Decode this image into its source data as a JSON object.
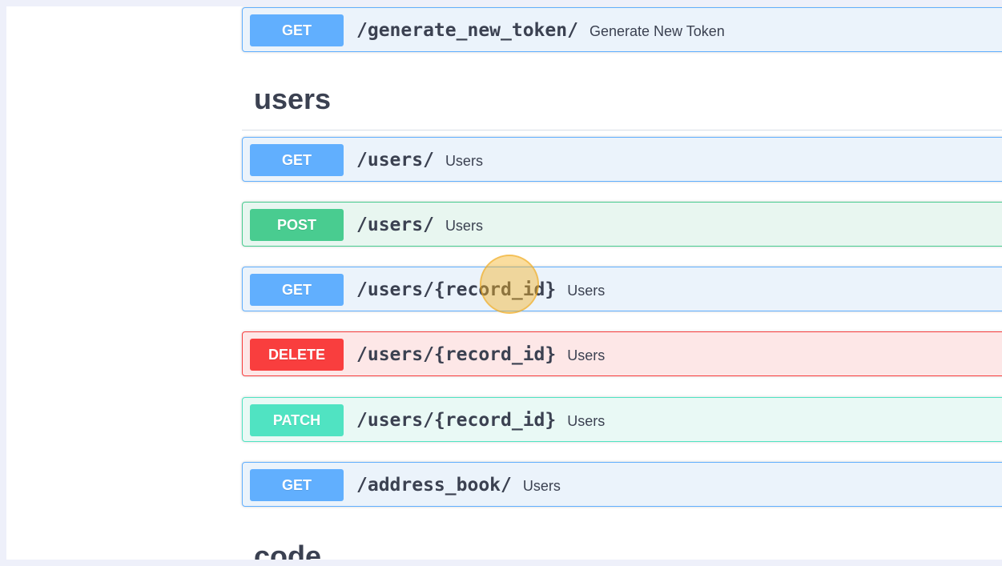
{
  "top_operation": {
    "method": "GET",
    "path": "/generate_new_token/",
    "summary": "Generate New Token"
  },
  "sections": {
    "users": {
      "title": "users",
      "operations": [
        {
          "method": "GET",
          "path": "/users/",
          "summary": "Users"
        },
        {
          "method": "POST",
          "path": "/users/",
          "summary": "Users"
        },
        {
          "method": "GET",
          "path": "/users/{record_id}",
          "summary": "Users"
        },
        {
          "method": "DELETE",
          "path": "/users/{record_id}",
          "summary": "Users"
        },
        {
          "method": "PATCH",
          "path": "/users/{record_id}",
          "summary": "Users"
        },
        {
          "method": "GET",
          "path": "/address_book/",
          "summary": "Users"
        }
      ]
    },
    "code": {
      "title": "code"
    }
  },
  "colors": {
    "get": "#61affe",
    "post": "#49cc90",
    "delete": "#f93e3e",
    "patch": "#50e3c2",
    "text": "#3b4151",
    "cursor_highlight": "#f5b428"
  }
}
